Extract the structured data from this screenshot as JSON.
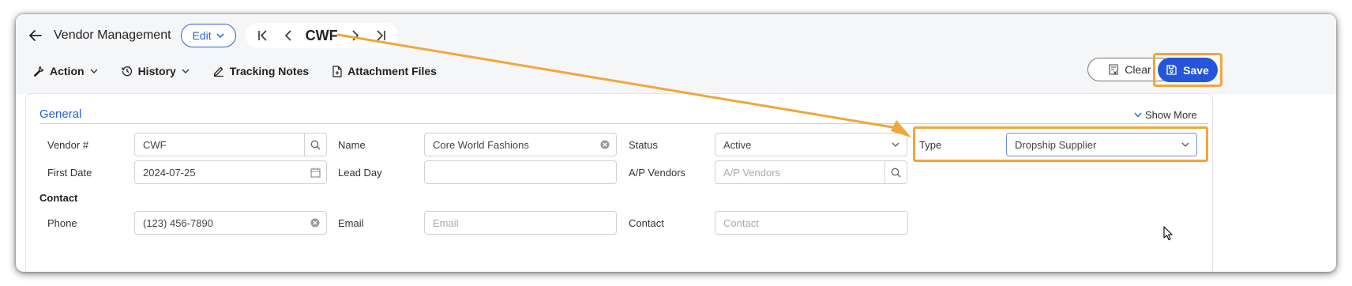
{
  "header": {
    "title": "Vendor Management",
    "edit_label": "Edit",
    "record_code": "CWF"
  },
  "toolbar": {
    "action": "Action",
    "history": "History",
    "tracking_notes": "Tracking Notes",
    "attachment_files": "Attachment Files",
    "clear": "Clear",
    "save": "Save"
  },
  "section": {
    "general_title": "General",
    "show_more": "Show More",
    "contact_title": "Contact"
  },
  "fields": {
    "vendor_no": {
      "label": "Vendor #",
      "value": "CWF"
    },
    "name": {
      "label": "Name",
      "value": "Core World Fashions"
    },
    "status": {
      "label": "Status",
      "value": "Active"
    },
    "type": {
      "label": "Type",
      "value": "Dropship Supplier"
    },
    "first_date": {
      "label": "First Date",
      "value": "2024-07-25"
    },
    "lead_day": {
      "label": "Lead Day",
      "value": ""
    },
    "ap_vendors": {
      "label": "A/P Vendors",
      "placeholder": "A/P Vendors"
    },
    "phone": {
      "label": "Phone",
      "value": "(123) 456-7890"
    },
    "email": {
      "label": "Email",
      "placeholder": "Email"
    },
    "contact": {
      "label": "Contact",
      "placeholder": "Contact"
    }
  },
  "colors": {
    "accent": "#2556d9",
    "highlight": "#f2a53a"
  }
}
